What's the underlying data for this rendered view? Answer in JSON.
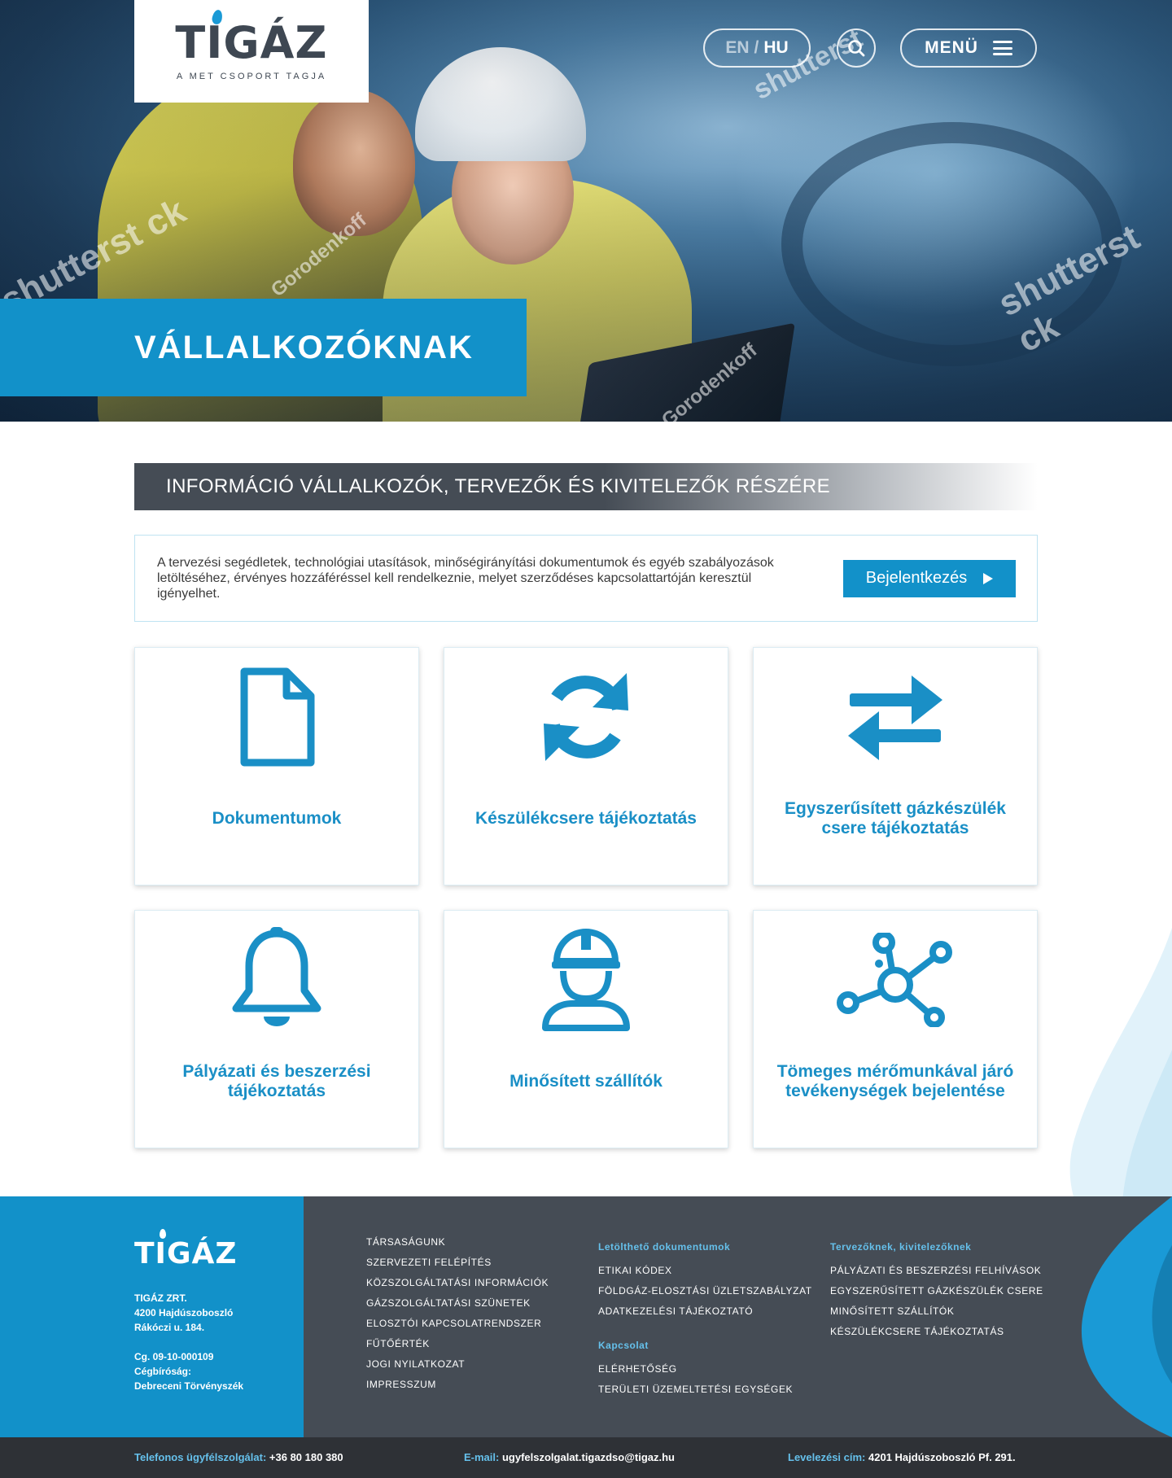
{
  "header": {
    "logo_text": "TIGÁZ",
    "logo_tagline": "A MET CSOPORT TAGJA",
    "lang_en": "EN",
    "lang_sep": "/",
    "lang_hu": "HU",
    "menu_label": "MENÜ"
  },
  "hero": {
    "title": "VÁLLALKOZÓKNAK",
    "watermarks": [
      "shutterst ck",
      "Gorodenkoff",
      "shutterst ck",
      "Gorodenkoff",
      "shutterst"
    ]
  },
  "section": {
    "title": "INFORMÁCIÓ VÁLLALKOZÓK, TERVEZŐK ÉS KIVITELEZŐK RÉSZÉRE"
  },
  "info": {
    "text": "A tervezési segédletek, technológiai utasítások, minőségirányítási dokumentumok és egyéb szabályozások letöltéséhez, érvényes hozzáféréssel kell rendelkeznie, melyet szerződéses kapcsolattartóján keresztül igényelhet.",
    "login_label": "Bejelentkezés"
  },
  "cards": [
    {
      "label": "Dokumentumok",
      "icon": "document-icon"
    },
    {
      "label": "Készülékcsere tájékoztatás",
      "icon": "refresh-icon"
    },
    {
      "label": "Egyszerűsített gázkészülék csere tájékoztatás",
      "icon": "exchange-arrows-icon"
    },
    {
      "label": "Pályázati és beszerzési tájékoztatás",
      "icon": "bell-icon"
    },
    {
      "label": "Minősített szállítók",
      "icon": "worker-helmet-icon"
    },
    {
      "label": "Tömeges mérőmunkával járó tevékenységek bejelentése",
      "icon": "network-nodes-icon"
    }
  ],
  "footer": {
    "logo_text": "TIGÁZ",
    "company": "TIGÁZ ZRT.",
    "address1": "4200 Hajdúszoboszló",
    "address2": "Rákóczi u. 184.",
    "reg": "Cg. 09-10-000109",
    "court_label": "Cégbíróság:",
    "court": "Debreceni Törvényszék",
    "col1": [
      "TÁRSASÁGUNK",
      "SZERVEZETI FELÉPÍTÉS",
      "KÖZSZOLGÁLTATÁSI INFORMÁCIÓK",
      "GÁZSZOLGÁLTATÁSI SZÜNETEK",
      "ELOSZTÓI KAPCSOLATRENDSZER",
      "FŰTŐÉRTÉK",
      "JOGI NYILATKOZAT",
      "IMPRESSZUM"
    ],
    "col2_head": "Letölthető dokumentumok",
    "col2": [
      "ETIKAI KÓDEX",
      "FÖLDGÁZ-ELOSZTÁSI ÜZLETSZABÁLYZAT",
      "ADATKEZELÉSI TÁJÉKOZTATÓ"
    ],
    "col2b_head": "Kapcsolat",
    "col2b": [
      "ELÉRHETŐSÉG",
      "TERÜLETI ÜZEMELTETÉSI EGYSÉGEK"
    ],
    "col3_head": "Tervezőknek, kivitelezőknek",
    "col3": [
      "PÁLYÁZATI ÉS BESZERZÉSI FELHÍVÁSOK",
      "EGYSZERŰSÍTETT GÁZKÉSZÜLÉK CSERE",
      "MINŐSÍTETT SZÁLLÍTÓK",
      "KÉSZÜLÉKCSERE TÁJÉKOZTATÁS"
    ]
  },
  "bottom_bar": {
    "phone_label": "Telefonos ügyfélszolgálat:",
    "phone": "+36 80 180 380",
    "email_label": "E-mail:",
    "email": "ugyfelszolgalat.tigazdso@tigaz.hu",
    "post_label": "Levelezési cím:",
    "post": "4201 Hajdúszoboszló Pf. 291."
  },
  "colors": {
    "brand_blue": "#1291c9",
    "dark_gray": "#454c55",
    "accent_light": "#65c0eb"
  }
}
